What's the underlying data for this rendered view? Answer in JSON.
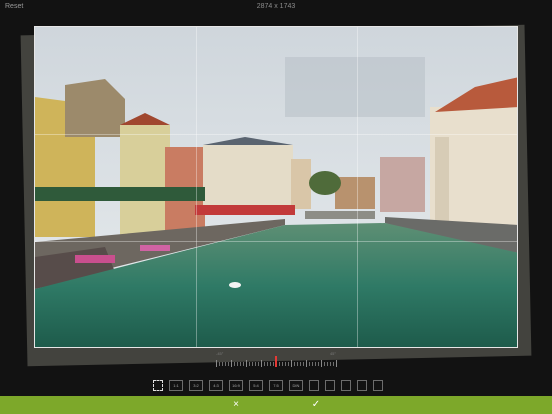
{
  "toolbar": {
    "reset_label": "Reset",
    "dimensions": "2874 x 1743"
  },
  "straighten": {
    "left_label": "-45°",
    "right_label": "45°",
    "value_fraction": 0.5
  },
  "aspect_ratios": [
    "",
    "1:1",
    "3:2",
    "4:3",
    "16:9",
    "5:4",
    "7:5",
    "DIN",
    "",
    "",
    "",
    "",
    ""
  ],
  "actions": {
    "cancel": "×",
    "confirm": "✓"
  },
  "colors": {
    "accent": "#7da82a",
    "needle": "#e53935",
    "background": "#121212"
  }
}
